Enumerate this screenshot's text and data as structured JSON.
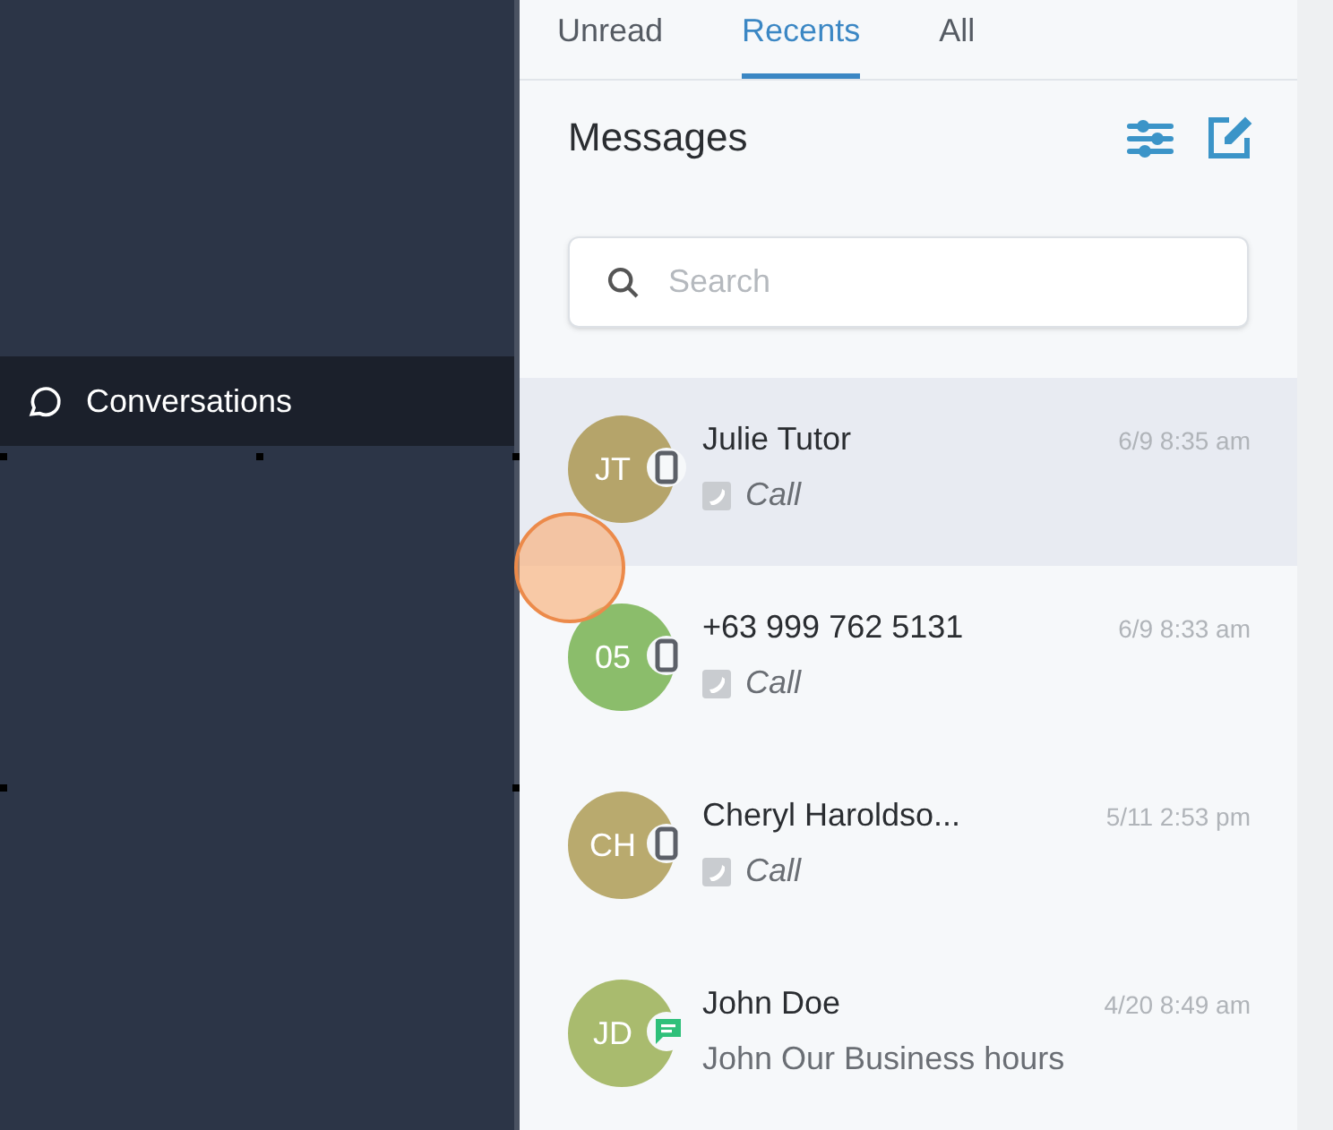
{
  "sidebar": {
    "items": [
      {
        "label": "Conversations",
        "selected": true
      }
    ]
  },
  "tabs": [
    {
      "label": "Unread",
      "selected": false
    },
    {
      "label": "Recents",
      "selected": true
    },
    {
      "label": "All",
      "selected": false
    }
  ],
  "header": {
    "title": "Messages"
  },
  "search": {
    "placeholder": "Search"
  },
  "conversations": [
    {
      "initials": "JT",
      "name": "Julie Tutor",
      "time": "6/9 8:35 am",
      "kind": "call",
      "badge": {
        "kind": "phone"
      },
      "preview": "Call",
      "color": "#b5a46a",
      "selected": true
    },
    {
      "initials": "05",
      "name": "+63 999 762 5131",
      "time": "6/9 8:33 am",
      "kind": "call",
      "badge": {
        "kind": "phone"
      },
      "preview": "Call",
      "color": "#8bbd6b",
      "selected": false
    },
    {
      "initials": "CH",
      "name": "Cheryl Haroldso...",
      "time": "5/11 2:53 pm",
      "kind": "call",
      "badge": {
        "kind": "phone"
      },
      "preview": "Call",
      "color": "#b9aa6e",
      "selected": false
    },
    {
      "initials": "JD",
      "name": "John Doe",
      "time": "4/20 8:49 am",
      "kind": "text",
      "badge": {
        "kind": "sms"
      },
      "preview": "John Our Business hours",
      "color": "#a9bb6e",
      "selected": false
    }
  ]
}
